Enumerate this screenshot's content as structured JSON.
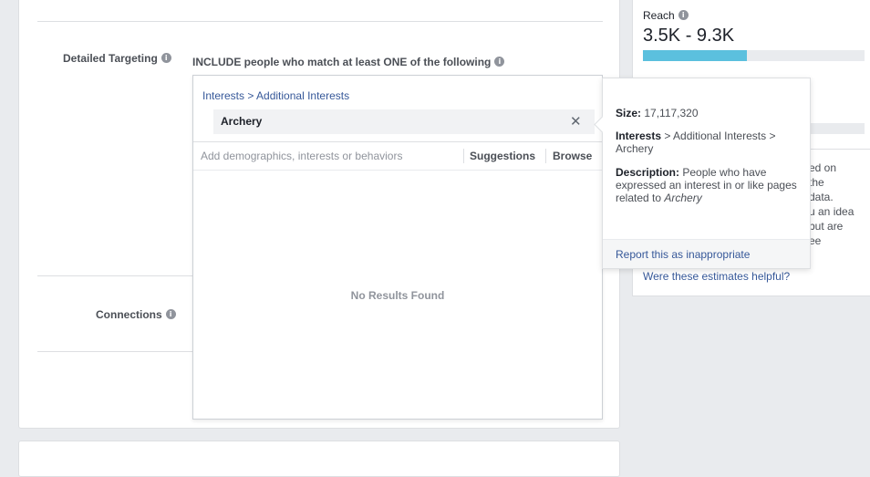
{
  "targeting": {
    "detailed_label": "Detailed Targeting",
    "include_text": "INCLUDE people who match at least ONE of the following",
    "info_glyph": "i",
    "connections_label": "Connections"
  },
  "picker": {
    "breadcrumb": "Interests > Additional Interests",
    "selected_item": "Archery",
    "remove_glyph": "✕",
    "search_placeholder": "Add demographics, interests or behaviors",
    "search_value": "",
    "suggestions_label": "Suggestions",
    "browse_label": "Browse",
    "no_results": "No Results Found"
  },
  "tooltip": {
    "size_label": "Size:",
    "size_value": "17,117,320",
    "path_bold": "Interests",
    "path_rest": " > Additional Interests > Archery",
    "desc_label": "Description:",
    "desc_text": " People who have expressed an interest in or like pages related to ",
    "desc_topic": "Archery",
    "report_link": "Report this as inappropriate"
  },
  "reach": {
    "label": "Reach",
    "value": "3.5K - 9.3K",
    "fill_fraction": 0.47,
    "partial_lines": [
      "ed on",
      "the",
      "data.",
      "u an idea",
      "but are",
      "ee"
    ],
    "helpful_link": "Were these estimates helpful?"
  },
  "colors": {
    "accent_blue": "#365899",
    "reach_bar": "#5bc0de"
  }
}
